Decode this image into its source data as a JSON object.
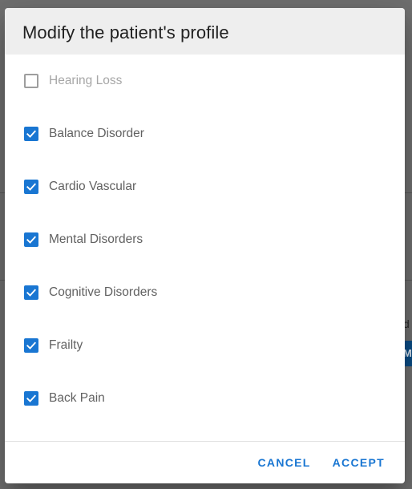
{
  "background": {
    "fragment_text": "d",
    "fragment_button": "M"
  },
  "dialog": {
    "title": "Modify the patient's profile",
    "options": [
      {
        "label": "Hearing Loss",
        "checked": false,
        "disabled": true
      },
      {
        "label": "Balance Disorder",
        "checked": true,
        "disabled": false
      },
      {
        "label": "Cardio Vascular",
        "checked": true,
        "disabled": false
      },
      {
        "label": "Mental Disorders",
        "checked": true,
        "disabled": false
      },
      {
        "label": "Cognitive Disorders",
        "checked": true,
        "disabled": false
      },
      {
        "label": "Frailty",
        "checked": true,
        "disabled": false
      },
      {
        "label": "Back Pain",
        "checked": true,
        "disabled": false
      }
    ],
    "actions": {
      "cancel_label": "CANCEL",
      "accept_label": "ACCEPT"
    }
  },
  "colors": {
    "accent": "#1976d2",
    "header_bg": "#eeeeee",
    "overlay": "#707070"
  }
}
